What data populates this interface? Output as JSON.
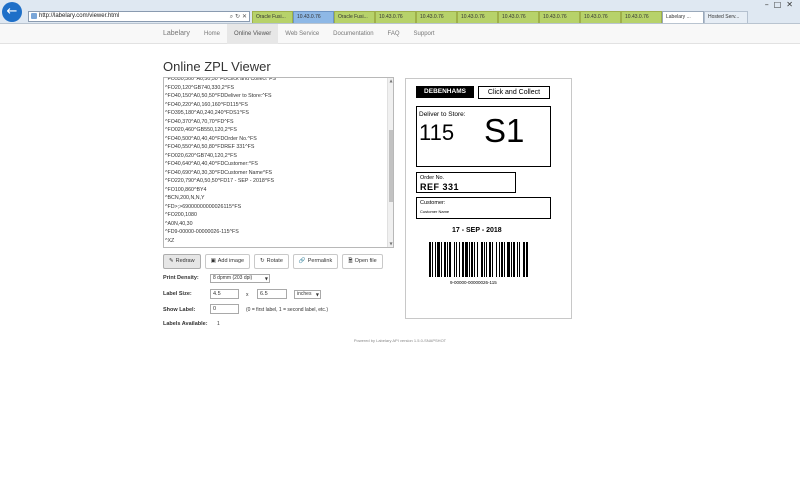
{
  "browser": {
    "url": "http://labelary.com/viewer.html",
    "tabs": [
      {
        "label": "Oracle Fusi...",
        "style": "green"
      },
      {
        "label": "10.43.0.76",
        "style": "blue"
      },
      {
        "label": "Oracle Fusi...",
        "style": "green"
      },
      {
        "label": "10.43.0.76",
        "style": "green"
      },
      {
        "label": "10.43.0.76",
        "style": "green"
      },
      {
        "label": "10.43.0.76",
        "style": "green"
      },
      {
        "label": "10.43.0.76",
        "style": "green"
      },
      {
        "label": "10.43.0.76",
        "style": "green"
      },
      {
        "label": "10.43.0.76",
        "style": "green"
      },
      {
        "label": "10.43.0.76",
        "style": "green"
      },
      {
        "label": "Labelary ...",
        "style": "active"
      },
      {
        "label": "Hosted Serv...",
        "style": "plain"
      }
    ]
  },
  "nav": {
    "brand": "Labelary",
    "items": [
      {
        "label": "Home",
        "active": false
      },
      {
        "label": "Online Viewer",
        "active": true
      },
      {
        "label": "Web Service",
        "active": false
      },
      {
        "label": "Documentation",
        "active": false
      },
      {
        "label": "FAQ",
        "active": false
      },
      {
        "label": "Support",
        "active": false
      }
    ]
  },
  "page": {
    "title": "Online ZPL Viewer",
    "zpl_lines": [
      "^FO530,300^A0,50,50^FDClick and Collect^FS",
      "^FO20,120^GB740,330,2^FS",
      "^FO40,150^A0,50,50^FDDeliver to Store:^FS",
      "^FO40,220^A0,160,160^FD115^FS",
      "^FO395,180^A0,240,240^FDS1^FS",
      "^FO40,370^A0,70,70^FD^FS",
      "^FO020,460^GB550,120,2^FS",
      "^FO40,500^A0,40,40^FDOrder No.^FS",
      "^FO40,550^A0,50,80^FDREF 331^FS",
      "^FO020,620^GB740,120,2^FS",
      "^FO40,640^A0,40,40^FDCustomer:^FS",
      "^FO40,690^A0,30,30^FDCustomer Name^FS",
      "^FO220,790^A0,50,50^FD17 - SEP - 2018^FS",
      "^FO100,860^BY4",
      "^BCN,200,N,N,Y",
      "^FD>;>69000000000026115^FS",
      "^FO200,1080",
      "^A0N,40,30",
      "^FD9-00000-00000026-115^FS",
      "^XZ"
    ],
    "buttons": {
      "redraw": "Redraw",
      "add_image": "Add image",
      "rotate": "Rotate",
      "permalink": "Permalink",
      "open_file": "Open file"
    },
    "print_density_label": "Print Density:",
    "print_density_value": "8 dpmm (203 dpi)",
    "label_size_label": "Label Size:",
    "label_width": "4.5",
    "size_x": "x",
    "label_height": "6.5",
    "unit_value": "inches",
    "show_label_label": "Show Label:",
    "show_label_value": "0",
    "show_label_hint": "(0 = first label, 1 = second label, etc.)",
    "labels_available_label": "Labels Available:",
    "labels_available_value": "1",
    "footer": "Powered by Labelary API version 1.5.0-SNAPSHOT"
  },
  "label_preview": {
    "store": "DEBENHAMS",
    "collect": "Click and Collect",
    "deliver_title": "Deliver to Store:",
    "store_number": "115",
    "store_code": "S1",
    "order_title": "Order No.",
    "order_ref": "REF 331",
    "customer_title": "Customer:",
    "customer_name": "Customer Name",
    "date": "17 - SEP - 2018",
    "barcode_text": "9-00000-00000026-115"
  }
}
